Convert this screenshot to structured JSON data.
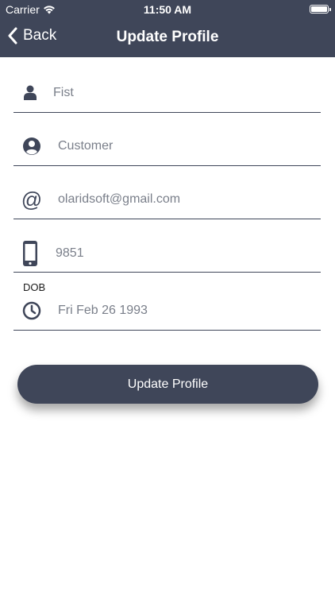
{
  "status_bar": {
    "carrier": "Carrier",
    "time": "11:50 AM"
  },
  "nav": {
    "back_label": "Back",
    "title": "Update Profile"
  },
  "form": {
    "first_name": {
      "placeholder": "Fist",
      "value": "",
      "icon": "person-icon"
    },
    "last_name": {
      "placeholder": "Customer",
      "value": "",
      "icon": "user-circle-icon"
    },
    "email": {
      "placeholder": "",
      "value": "olaridsoft@gmail.com",
      "icon": "at-icon"
    },
    "phone": {
      "placeholder": "",
      "value": "9851",
      "icon": "mobile-phone-icon"
    },
    "dob": {
      "label": "DOB",
      "value": "Fri Feb 26 1993",
      "icon": "clock-icon"
    }
  },
  "update_button_label": "Update Profile",
  "colors": {
    "header_bg": "#3f4659",
    "accent": "#3f4659",
    "text_muted": "#7a7f8a"
  }
}
